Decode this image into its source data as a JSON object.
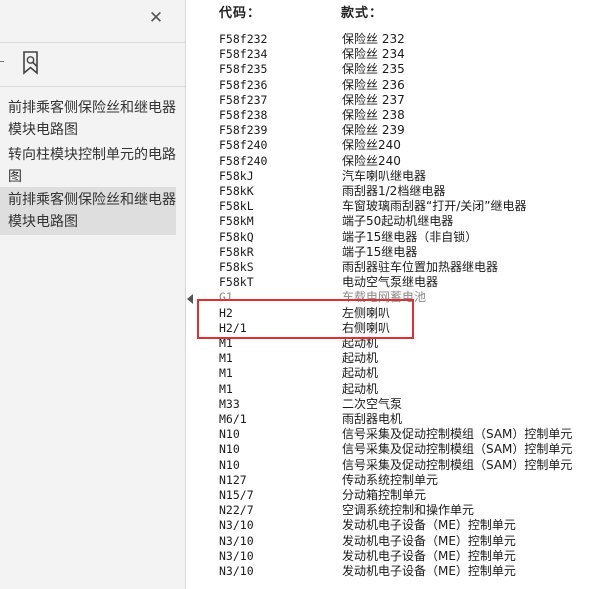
{
  "sidebar": {
    "close_label": "✕",
    "items": [
      {
        "label": "前排乘客侧保险丝和继电器模块电路图",
        "selected": false
      },
      {
        "label": "转向柱模块控制单元的电路图",
        "selected": false
      },
      {
        "label": "前排乘客侧保险丝和继电器模块电路图",
        "selected": true
      }
    ]
  },
  "document": {
    "header_code": "代码：",
    "header_name": "款式：",
    "rows": [
      {
        "code": "F58f232",
        "name": "保险丝 232"
      },
      {
        "code": "F58f234",
        "name": "保险丝 234"
      },
      {
        "code": "F58f235",
        "name": "保险丝 235"
      },
      {
        "code": "F58f236",
        "name": "保险丝 236"
      },
      {
        "code": "F58f237",
        "name": "保险丝 237"
      },
      {
        "code": "F58f238",
        "name": "保险丝 238"
      },
      {
        "code": "F58f239",
        "name": "保险丝 239"
      },
      {
        "code": "F58f240",
        "name": "保险丝240"
      },
      {
        "code": "F58f240",
        "name": "保险丝240"
      },
      {
        "code": "F58kJ",
        "name": "汽车喇叭继电器"
      },
      {
        "code": "F58kK",
        "name": "雨刮器1/2档继电器"
      },
      {
        "code": "F58kL",
        "name": "车窗玻璃雨刮器“打开/关闭”继电器"
      },
      {
        "code": "F58kM",
        "name": "端子50起动机继电器"
      },
      {
        "code": "F58kQ",
        "name": "端子15继电器（非自锁）"
      },
      {
        "code": "F58kR",
        "name": "端子15继电器"
      },
      {
        "code": "F58kS",
        "name": "雨刮器驻车位置加热器继电器"
      },
      {
        "code": "F58kT",
        "name": "电动空气泵继电器"
      },
      {
        "code": "G1",
        "name": "车载电网蓄电池",
        "faint": true
      },
      {
        "code": "H2",
        "name": "左侧喇叭"
      },
      {
        "code": "H2/1",
        "name": "右侧喇叭"
      },
      {
        "code": "M1",
        "name": "起动机"
      },
      {
        "code": "M1",
        "name": "起动机"
      },
      {
        "code": "M1",
        "name": "起动机"
      },
      {
        "code": "M1",
        "name": "起动机"
      },
      {
        "code": "M33",
        "name": "二次空气泵"
      },
      {
        "code": "M6/1",
        "name": "雨刮器电机"
      },
      {
        "code": "N10",
        "name": "信号采集及促动控制模组（SAM）控制单元"
      },
      {
        "code": "N10",
        "name": "信号采集及促动控制模组（SAM）控制单元"
      },
      {
        "code": "N10",
        "name": "信号采集及促动控制模组（SAM）控制单元"
      },
      {
        "code": "N127",
        "name": "传动系统控制单元"
      },
      {
        "code": "N15/7",
        "name": "分动箱控制单元"
      },
      {
        "code": "N22/7",
        "name": "空调系统控制和操作单元"
      },
      {
        "code": "N3/10",
        "name": "发动机电子设备（ME）控制单元"
      },
      {
        "code": "N3/10",
        "name": "发动机电子设备（ME）控制单元"
      },
      {
        "code": "N3/10",
        "name": "发动机电子设备（ME）控制单元"
      },
      {
        "code": "N3/10",
        "name": "发动机电子设备（ME）控制单元"
      }
    ]
  },
  "colors": {
    "highlight_border": "#e03030",
    "sidebar_bg": "#f3f3f3",
    "selected_bg": "#dedede"
  },
  "icons": {
    "close": "close-icon",
    "bookmark": "bookmark-search-icon",
    "collapse": "collapse-arrow-icon"
  }
}
